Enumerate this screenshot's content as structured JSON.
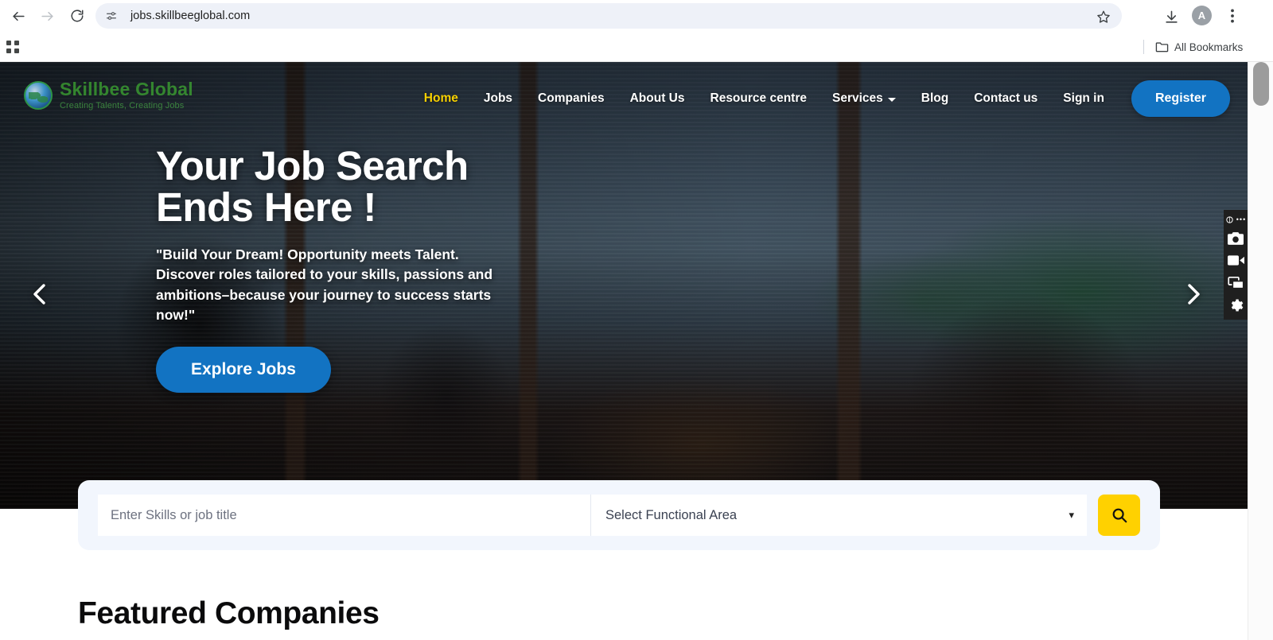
{
  "browser": {
    "url": "jobs.skillbeeglobal.com",
    "back_icon": "back-arrow-icon",
    "forward_icon": "forward-arrow-icon",
    "reload_icon": "reload-icon",
    "site_info_icon": "site-settings-icon",
    "bookmark_icon": "star-icon",
    "downloads_icon": "download-icon",
    "profile_initial": "A",
    "menu_icon": "three-dot-menu-icon",
    "apps_icon": "apps-grid-icon",
    "all_bookmarks_label": "All Bookmarks",
    "folder_icon": "folder-icon"
  },
  "site": {
    "brand": {
      "name": "Skillbee Global",
      "tagline": "Creating Talents, Creating Jobs",
      "logo_icon": "globe-icon"
    },
    "nav": {
      "items": [
        {
          "label": "Home",
          "active": true,
          "has_caret": false
        },
        {
          "label": "Jobs",
          "active": false,
          "has_caret": false
        },
        {
          "label": "Companies",
          "active": false,
          "has_caret": false
        },
        {
          "label": "About Us",
          "active": false,
          "has_caret": false
        },
        {
          "label": "Resource centre",
          "active": false,
          "has_caret": false
        },
        {
          "label": "Services",
          "active": false,
          "has_caret": true
        },
        {
          "label": "Blog",
          "active": false,
          "has_caret": false
        },
        {
          "label": "Contact us",
          "active": false,
          "has_caret": false
        },
        {
          "label": "Sign in",
          "active": false,
          "has_caret": false
        }
      ],
      "register_label": "Register",
      "active_color": "#f7d000",
      "register_bg": "#1273c2"
    },
    "hero": {
      "title": "Your Job Search\nEnds Here !",
      "subtitle": "\"Build Your Dream! Opportunity meets Talent. Discover roles tailored to your skills, passions and ambitions–because your journey to success starts now!\"",
      "cta_label": "Explore Jobs",
      "prev_icon": "chevron-left-icon",
      "next_icon": "chevron-right-icon"
    },
    "search": {
      "skills_placeholder": "Enter Skills or job title",
      "skills_value": "",
      "functional_area_value": "Select Functional Area",
      "caret_icon": "chevron-down-icon",
      "submit_icon": "search-icon",
      "submit_bg": "#ffd100",
      "panel_bg": "#f2f6fd"
    },
    "featured": {
      "heading": "Featured Companies"
    }
  },
  "recorder": {
    "logo_icon": "recorder-logo-icon",
    "dots": "•••",
    "items": [
      {
        "icon": "camera-icon"
      },
      {
        "icon": "video-camera-icon"
      },
      {
        "icon": "windows-capture-icon"
      },
      {
        "icon": "gear-icon"
      }
    ]
  }
}
